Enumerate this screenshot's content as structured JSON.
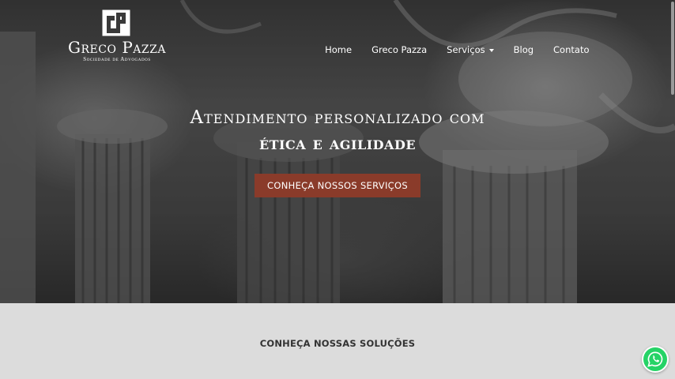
{
  "brand": {
    "mark": "GP",
    "name": "Greco Pazza",
    "tagline": "Sociedade de Advogados"
  },
  "nav": {
    "items": [
      {
        "label": "Home"
      },
      {
        "label": "Greco Pazza"
      },
      {
        "label": "Serviços",
        "has_dropdown": true
      },
      {
        "label": "Blog"
      },
      {
        "label": "Contato"
      }
    ]
  },
  "hero": {
    "line1": "Atendimento personalizado com",
    "line2": "ética e agilidade",
    "cta_label": "CONHEÇA NOSSOS SERVIÇOS"
  },
  "solutions": {
    "title": "CONHEÇA NOSSAS SOLUÇÕES"
  },
  "floating": {
    "icon": "whatsapp-icon"
  },
  "colors": {
    "cta": "#8a3b2a",
    "section_bg": "#dcdcdc",
    "whatsapp": "#25d366"
  }
}
